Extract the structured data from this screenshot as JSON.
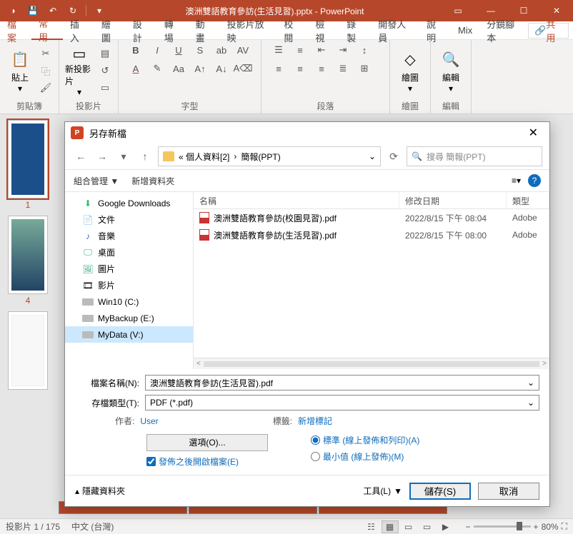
{
  "titlebar": {
    "filename": "澳洲雙語教育參訪(生活見習).pptx - PowerPoint"
  },
  "ribbon_tabs": {
    "file": "檔案",
    "home": "常用",
    "insert": "插入",
    "draw": "繪圖",
    "design": "設計",
    "transitions": "轉場",
    "animations": "動畫",
    "slideshow": "投影片放映",
    "review": "校閱",
    "view": "檢視",
    "record": "錄製",
    "developer": "開發人員",
    "help": "說明",
    "mix": "Mix",
    "camtasia": "分鏡腳本",
    "share": "共用"
  },
  "ribbon_groups": {
    "clipboard": "剪貼簿",
    "paste": "貼上",
    "slides": "投影片",
    "new_slide": "新投影片",
    "font": "字型",
    "paragraph": "段落",
    "drawing": "繪圖",
    "editing": "編輯"
  },
  "thumbs": {
    "n1": "1",
    "n4": "4"
  },
  "status": {
    "slide": "投影片 1 / 175",
    "lang": "中文 (台灣)",
    "zoom": "80%"
  },
  "dialog": {
    "title": "另存新檔",
    "breadcrumb_a": "« 個人資料[2]",
    "breadcrumb_b": "簡報(PPT)",
    "search_placeholder": "搜尋 簡報(PPT)",
    "organize": "組合管理",
    "new_folder": "新增資料夾",
    "tree": {
      "gdl": "Google Downloads",
      "docs": "文件",
      "music": "音樂",
      "desktop": "桌面",
      "pictures": "圖片",
      "videos": "影片",
      "c": "Win10 (C:)",
      "e": "MyBackup (E:)",
      "v": "MyData (V:)"
    },
    "cols": {
      "name": "名稱",
      "date": "修改日期",
      "type": "類型"
    },
    "files": [
      {
        "name": "澳洲雙語教育參訪(校園見習).pdf",
        "date": "2022/8/15 下午 08:04",
        "type": "Adobe"
      },
      {
        "name": "澳洲雙語教育參訪(生活見習).pdf",
        "date": "2022/8/15 下午 08:00",
        "type": "Adobe"
      }
    ],
    "filename_label": "檔案名稱(N):",
    "filename_value": "澳洲雙語教育參訪(生活見習).pdf",
    "filetype_label": "存檔類型(T):",
    "filetype_value": "PDF (*.pdf)",
    "author_label": "作者:",
    "author_value": "User",
    "tags_label": "標籤:",
    "tags_value": "新增標記",
    "options_btn": "選項(O)...",
    "open_after": "發佈之後開啟檔案(E)",
    "radio_std": "標準 (線上發佈和列印)(A)",
    "radio_min": "最小值 (線上發佈)(M)",
    "hide_folders": "隱藏資料夾",
    "tools": "工具(L)",
    "save": "儲存(S)",
    "cancel": "取消"
  }
}
